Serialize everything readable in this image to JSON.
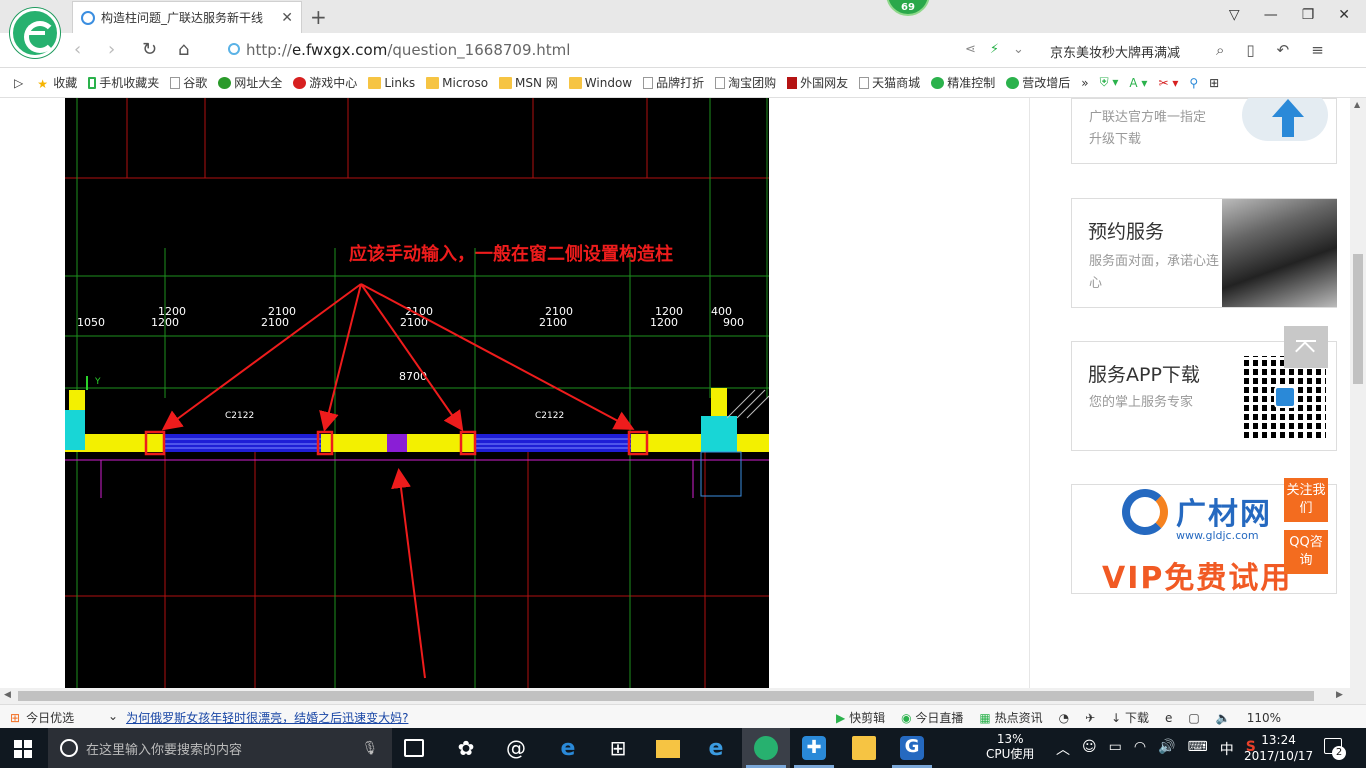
{
  "browser": {
    "tab_title": "构造柱问题_广联达服务新干线",
    "new_tab": "+",
    "badge": "69",
    "url_scheme": "http://",
    "url_host": "e.fwxgx.com",
    "url_path": "/question_1668709.html",
    "search_hint": "京东美妆秒大牌再满减",
    "window_controls": [
      "▽",
      "—",
      "❐",
      "✕"
    ]
  },
  "bookmarks": [
    {
      "label": "收藏",
      "icon": "star-icon"
    },
    {
      "label": "手机收藏夹",
      "icon": "phone-icon"
    },
    {
      "label": "谷歌",
      "icon": "page-icon"
    },
    {
      "label": "网址大全",
      "icon": "globe-icon"
    },
    {
      "label": "游戏中心",
      "icon": "game-icon"
    },
    {
      "label": "Links",
      "icon": "folder-icon"
    },
    {
      "label": "Microso",
      "icon": "folder-icon"
    },
    {
      "label": "MSN 网",
      "icon": "folder-icon"
    },
    {
      "label": "Window",
      "icon": "folder-icon"
    },
    {
      "label": "品牌打折",
      "icon": "page-icon"
    },
    {
      "label": "淘宝团购",
      "icon": "page-icon"
    },
    {
      "label": "外国网友",
      "icon": "bookmark-icon"
    },
    {
      "label": "天猫商城",
      "icon": "page-icon"
    },
    {
      "label": "精准控制",
      "icon": "wechat-icon"
    },
    {
      "label": "营改增后",
      "icon": "wechat-icon"
    }
  ],
  "cad": {
    "annotation": "应该手动输入，一般在窗二侧设置构造柱",
    "dims_top": [
      "1200",
      "2100",
      "2100",
      "2100",
      "1200",
      "400"
    ],
    "dims_bottom": [
      "1050",
      "1200",
      "2100",
      "2100",
      "2100",
      "1200",
      "900"
    ],
    "total": "8700",
    "window_labels": [
      "C2122",
      "C2122"
    ],
    "axis_label": "Y"
  },
  "sidebar": {
    "card1_text": "广联达官方唯一指定升级下载",
    "card2_title": "预约服务",
    "card2_sub": "服务面对面，承诺心连心",
    "card3_title": "服务APP下载",
    "card3_sub": "您的掌上服务专家",
    "card4_brand": "广材网",
    "card4_url": "www.gldjc.com",
    "card4_vip": "VIP免费试用",
    "float_follow": "关注我们",
    "float_qq": "QQ咨询"
  },
  "statusbar": {
    "today": "今日优选",
    "news": "为何俄罗斯女孩年轻时很漂亮，结婚之后迅速变大妈?",
    "quick_cut": "快剪辑",
    "live": "今日直播",
    "hot": "热点资讯",
    "download": "下载",
    "zoom": "110%"
  },
  "taskbar": {
    "search_placeholder": "在这里输入你要搜索的内容",
    "cpu_value": "13%",
    "cpu_label": "CPU使用",
    "ime": "中",
    "time": "13:24",
    "date": "2017/10/17",
    "notifications": "2"
  },
  "colors": {
    "accent_red": "#ee1c1c",
    "cad_yellow": "#f3f000",
    "cad_blue": "#1e1ed6",
    "orange": "#f36c1f"
  }
}
